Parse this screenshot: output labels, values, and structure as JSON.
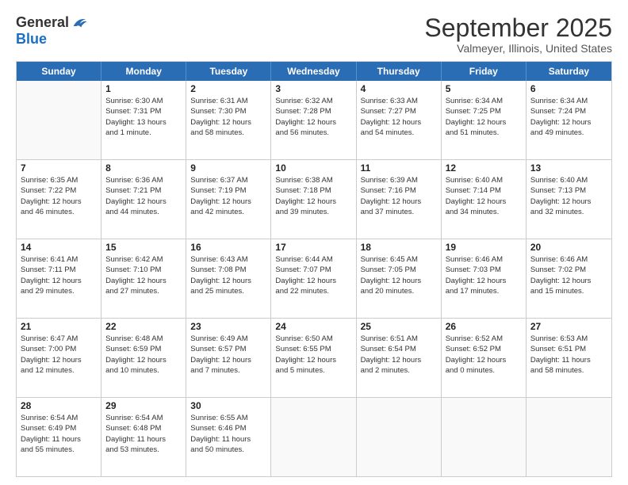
{
  "header": {
    "logo_general": "General",
    "logo_blue": "Blue",
    "month_title": "September 2025",
    "location": "Valmeyer, Illinois, United States"
  },
  "days_of_week": [
    "Sunday",
    "Monday",
    "Tuesday",
    "Wednesday",
    "Thursday",
    "Friday",
    "Saturday"
  ],
  "weeks": [
    [
      {
        "day": "",
        "lines": []
      },
      {
        "day": "1",
        "lines": [
          "Sunrise: 6:30 AM",
          "Sunset: 7:31 PM",
          "Daylight: 13 hours",
          "and 1 minute."
        ]
      },
      {
        "day": "2",
        "lines": [
          "Sunrise: 6:31 AM",
          "Sunset: 7:30 PM",
          "Daylight: 12 hours",
          "and 58 minutes."
        ]
      },
      {
        "day": "3",
        "lines": [
          "Sunrise: 6:32 AM",
          "Sunset: 7:28 PM",
          "Daylight: 12 hours",
          "and 56 minutes."
        ]
      },
      {
        "day": "4",
        "lines": [
          "Sunrise: 6:33 AM",
          "Sunset: 7:27 PM",
          "Daylight: 12 hours",
          "and 54 minutes."
        ]
      },
      {
        "day": "5",
        "lines": [
          "Sunrise: 6:34 AM",
          "Sunset: 7:25 PM",
          "Daylight: 12 hours",
          "and 51 minutes."
        ]
      },
      {
        "day": "6",
        "lines": [
          "Sunrise: 6:34 AM",
          "Sunset: 7:24 PM",
          "Daylight: 12 hours",
          "and 49 minutes."
        ]
      }
    ],
    [
      {
        "day": "7",
        "lines": [
          "Sunrise: 6:35 AM",
          "Sunset: 7:22 PM",
          "Daylight: 12 hours",
          "and 46 minutes."
        ]
      },
      {
        "day": "8",
        "lines": [
          "Sunrise: 6:36 AM",
          "Sunset: 7:21 PM",
          "Daylight: 12 hours",
          "and 44 minutes."
        ]
      },
      {
        "day": "9",
        "lines": [
          "Sunrise: 6:37 AM",
          "Sunset: 7:19 PM",
          "Daylight: 12 hours",
          "and 42 minutes."
        ]
      },
      {
        "day": "10",
        "lines": [
          "Sunrise: 6:38 AM",
          "Sunset: 7:18 PM",
          "Daylight: 12 hours",
          "and 39 minutes."
        ]
      },
      {
        "day": "11",
        "lines": [
          "Sunrise: 6:39 AM",
          "Sunset: 7:16 PM",
          "Daylight: 12 hours",
          "and 37 minutes."
        ]
      },
      {
        "day": "12",
        "lines": [
          "Sunrise: 6:40 AM",
          "Sunset: 7:14 PM",
          "Daylight: 12 hours",
          "and 34 minutes."
        ]
      },
      {
        "day": "13",
        "lines": [
          "Sunrise: 6:40 AM",
          "Sunset: 7:13 PM",
          "Daylight: 12 hours",
          "and 32 minutes."
        ]
      }
    ],
    [
      {
        "day": "14",
        "lines": [
          "Sunrise: 6:41 AM",
          "Sunset: 7:11 PM",
          "Daylight: 12 hours",
          "and 29 minutes."
        ]
      },
      {
        "day": "15",
        "lines": [
          "Sunrise: 6:42 AM",
          "Sunset: 7:10 PM",
          "Daylight: 12 hours",
          "and 27 minutes."
        ]
      },
      {
        "day": "16",
        "lines": [
          "Sunrise: 6:43 AM",
          "Sunset: 7:08 PM",
          "Daylight: 12 hours",
          "and 25 minutes."
        ]
      },
      {
        "day": "17",
        "lines": [
          "Sunrise: 6:44 AM",
          "Sunset: 7:07 PM",
          "Daylight: 12 hours",
          "and 22 minutes."
        ]
      },
      {
        "day": "18",
        "lines": [
          "Sunrise: 6:45 AM",
          "Sunset: 7:05 PM",
          "Daylight: 12 hours",
          "and 20 minutes."
        ]
      },
      {
        "day": "19",
        "lines": [
          "Sunrise: 6:46 AM",
          "Sunset: 7:03 PM",
          "Daylight: 12 hours",
          "and 17 minutes."
        ]
      },
      {
        "day": "20",
        "lines": [
          "Sunrise: 6:46 AM",
          "Sunset: 7:02 PM",
          "Daylight: 12 hours",
          "and 15 minutes."
        ]
      }
    ],
    [
      {
        "day": "21",
        "lines": [
          "Sunrise: 6:47 AM",
          "Sunset: 7:00 PM",
          "Daylight: 12 hours",
          "and 12 minutes."
        ]
      },
      {
        "day": "22",
        "lines": [
          "Sunrise: 6:48 AM",
          "Sunset: 6:59 PM",
          "Daylight: 12 hours",
          "and 10 minutes."
        ]
      },
      {
        "day": "23",
        "lines": [
          "Sunrise: 6:49 AM",
          "Sunset: 6:57 PM",
          "Daylight: 12 hours",
          "and 7 minutes."
        ]
      },
      {
        "day": "24",
        "lines": [
          "Sunrise: 6:50 AM",
          "Sunset: 6:55 PM",
          "Daylight: 12 hours",
          "and 5 minutes."
        ]
      },
      {
        "day": "25",
        "lines": [
          "Sunrise: 6:51 AM",
          "Sunset: 6:54 PM",
          "Daylight: 12 hours",
          "and 2 minutes."
        ]
      },
      {
        "day": "26",
        "lines": [
          "Sunrise: 6:52 AM",
          "Sunset: 6:52 PM",
          "Daylight: 12 hours",
          "and 0 minutes."
        ]
      },
      {
        "day": "27",
        "lines": [
          "Sunrise: 6:53 AM",
          "Sunset: 6:51 PM",
          "Daylight: 11 hours",
          "and 58 minutes."
        ]
      }
    ],
    [
      {
        "day": "28",
        "lines": [
          "Sunrise: 6:54 AM",
          "Sunset: 6:49 PM",
          "Daylight: 11 hours",
          "and 55 minutes."
        ]
      },
      {
        "day": "29",
        "lines": [
          "Sunrise: 6:54 AM",
          "Sunset: 6:48 PM",
          "Daylight: 11 hours",
          "and 53 minutes."
        ]
      },
      {
        "day": "30",
        "lines": [
          "Sunrise: 6:55 AM",
          "Sunset: 6:46 PM",
          "Daylight: 11 hours",
          "and 50 minutes."
        ]
      },
      {
        "day": "",
        "lines": []
      },
      {
        "day": "",
        "lines": []
      },
      {
        "day": "",
        "lines": []
      },
      {
        "day": "",
        "lines": []
      }
    ]
  ]
}
